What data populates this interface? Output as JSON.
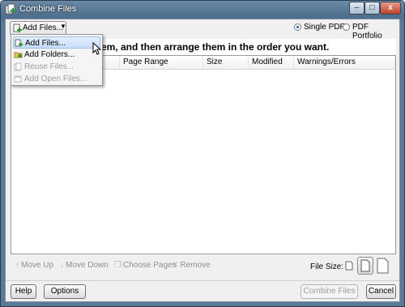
{
  "window": {
    "title": "Combine Files",
    "caption_buttons": {
      "minimize": "–",
      "maximize": "□",
      "close": "x"
    }
  },
  "toolbar": {
    "add_files_label": "Add Files...",
    "add_files_caret": "▼",
    "output_options": [
      {
        "label": "Single PDF",
        "selected": true
      },
      {
        "label": "PDF Portfolio",
        "selected": false
      }
    ]
  },
  "instruction": "dd them, and then arrange them in the order you want.",
  "file_list": {
    "columns": [
      "Page Range",
      "Size",
      "Modified",
      "Warnings/Errors"
    ]
  },
  "dropdown_menu": {
    "items": [
      {
        "label": "Add Files...",
        "highlighted": true,
        "enabled": true
      },
      {
        "label": "Add Folders...",
        "highlighted": false,
        "enabled": true
      },
      {
        "label": "Reuse Files...",
        "highlighted": false,
        "enabled": false
      },
      {
        "label": "Add Open Files...",
        "highlighted": false,
        "enabled": false
      }
    ]
  },
  "list_actions": {
    "move_up": "Move Up",
    "move_down": "Move Down",
    "choose_pages": "Choose Pages",
    "remove": "Remove"
  },
  "file_size": {
    "label": "File Size:",
    "selected": "default"
  },
  "footer": {
    "help": "Help",
    "options": "Options",
    "combine_files": "Combine Files",
    "cancel": "Cancel"
  },
  "colors": {
    "titlebar": "#4e6f8c",
    "highlight": "#c6dcf6",
    "radio_dot": "#1c5fb4",
    "disabled_text": "#9c9c9c"
  }
}
